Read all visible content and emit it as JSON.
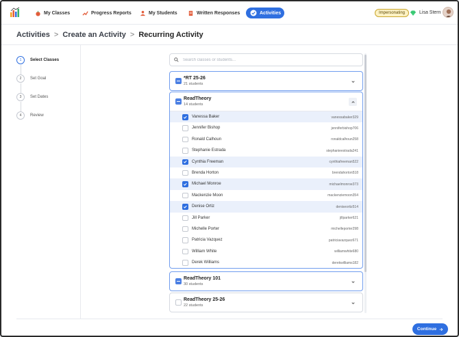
{
  "nav": {
    "items": [
      {
        "label": "My Classes",
        "icon": "apple-icon",
        "active": false
      },
      {
        "label": "Progress Reports",
        "icon": "chart-icon",
        "active": false
      },
      {
        "label": "My Students",
        "icon": "students-icon",
        "active": false
      },
      {
        "label": "Written Responses",
        "icon": "document-icon",
        "active": false
      },
      {
        "label": "Activities",
        "icon": "check-circle-icon",
        "active": true
      }
    ],
    "impersonating_badge": "Impersonating",
    "user_name": "Lisa Stern"
  },
  "breadcrumb": {
    "items": [
      "Activities",
      "Create an Activity",
      "Recurring Activity"
    ],
    "separator": ">"
  },
  "steps": [
    {
      "number": "1",
      "label": "Select Classes",
      "active": true
    },
    {
      "number": "2",
      "label": "Set Goal",
      "active": false
    },
    {
      "number": "3",
      "label": "Set Dates",
      "active": false
    },
    {
      "number": "4",
      "label": "Review",
      "active": false
    }
  ],
  "search": {
    "placeholder": "Search classes or students...",
    "value": ""
  },
  "classes": [
    {
      "name": "*RT 25-26",
      "count": "21 students",
      "state": "partial",
      "expanded": false
    },
    {
      "name": "ReadTheory",
      "count": "14 students",
      "state": "partial",
      "expanded": true,
      "students": [
        {
          "name": "Vanessa Baker",
          "username": "vanessabaker329",
          "checked": true
        },
        {
          "name": "Jennifer Bishop",
          "username": "jenniferbishop706",
          "checked": false
        },
        {
          "name": "Ronald Calhoun",
          "username": "ronaldcalhoun258",
          "checked": false
        },
        {
          "name": "Stephanie Estrada",
          "username": "stephanieestrada241",
          "checked": false
        },
        {
          "name": "Cynthia Freeman",
          "username": "cynthiafreeman522",
          "checked": true
        },
        {
          "name": "Brenda Horton",
          "username": "brendahorton518",
          "checked": false
        },
        {
          "name": "Michael Monroe",
          "username": "michaelmonroe373",
          "checked": true
        },
        {
          "name": "Mackenzie Moon",
          "username": "mackenziemoon354",
          "checked": false
        },
        {
          "name": "Denise Ortiz",
          "username": "deniseortiz514",
          "checked": true
        },
        {
          "name": "Jill Parker",
          "username": "jillparker621",
          "checked": false
        },
        {
          "name": "Michelle Porter",
          "username": "michelleporter298",
          "checked": false
        },
        {
          "name": "Patricia Vazquez",
          "username": "patriciavazquez671",
          "checked": false
        },
        {
          "name": "William White",
          "username": "williamwhite680",
          "checked": false
        },
        {
          "name": "Derek Williams",
          "username": "derekwilliams182",
          "checked": false
        }
      ]
    },
    {
      "name": "ReadTheory 101",
      "count": "30 students",
      "state": "partial",
      "expanded": false
    },
    {
      "name": "ReadTheory 25-26",
      "count": "22 students",
      "state": "none",
      "expanded": false
    }
  ],
  "footer": {
    "continue_label": "Continue"
  },
  "colors": {
    "accent": "#2f6fe0",
    "selected_row": "#eaf0fb",
    "badge_bg": "#fdf2c4"
  }
}
